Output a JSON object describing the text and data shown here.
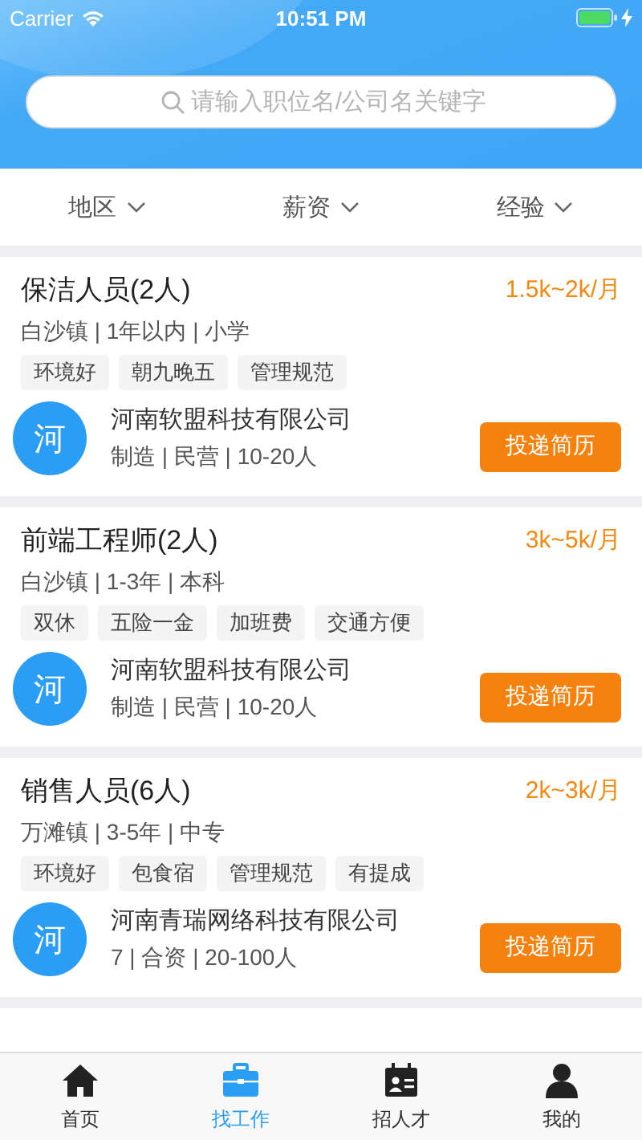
{
  "status_bar": {
    "carrier": "Carrier",
    "time": "10:51 PM"
  },
  "search": {
    "placeholder": "请输入职位名/公司名关键字"
  },
  "filters": [
    {
      "label": "地区"
    },
    {
      "label": "薪资"
    },
    {
      "label": "经验"
    }
  ],
  "jobs": [
    {
      "title": "保洁人员(2人)",
      "salary": "1.5k~2k/月",
      "meta": "白沙镇 | 1年以内 | 小学",
      "tags": [
        "环境好",
        "朝九晚五",
        "管理规范"
      ],
      "company": {
        "avatar": "河",
        "name": "河南软盟科技有限公司",
        "info": "制造 | 民营 | 10-20人"
      },
      "button": "投递简历"
    },
    {
      "title": "前端工程师(2人)",
      "salary": "3k~5k/月",
      "meta": "白沙镇 | 1-3年 | 本科",
      "tags": [
        "双休",
        "五险一金",
        "加班费",
        "交通方便"
      ],
      "company": {
        "avatar": "河",
        "name": "河南软盟科技有限公司",
        "info": "制造 | 民营 | 10-20人"
      },
      "button": "投递简历"
    },
    {
      "title": "销售人员(6人)",
      "salary": "2k~3k/月",
      "meta": "万滩镇 | 3-5年 | 中专",
      "tags": [
        "环境好",
        "包食宿",
        "管理规范",
        "有提成"
      ],
      "company": {
        "avatar": "河",
        "name": "河南青瑞网络科技有限公司",
        "info": "7 | 合资 | 20-100人"
      },
      "button": "投递简历"
    }
  ],
  "tabs": [
    {
      "kind": "home",
      "label": "首页",
      "selected": false
    },
    {
      "kind": "jobs",
      "label": "找工作",
      "selected": true
    },
    {
      "kind": "talent",
      "label": "招人才",
      "selected": false
    },
    {
      "kind": "profile",
      "label": "我的",
      "selected": false
    }
  ]
}
